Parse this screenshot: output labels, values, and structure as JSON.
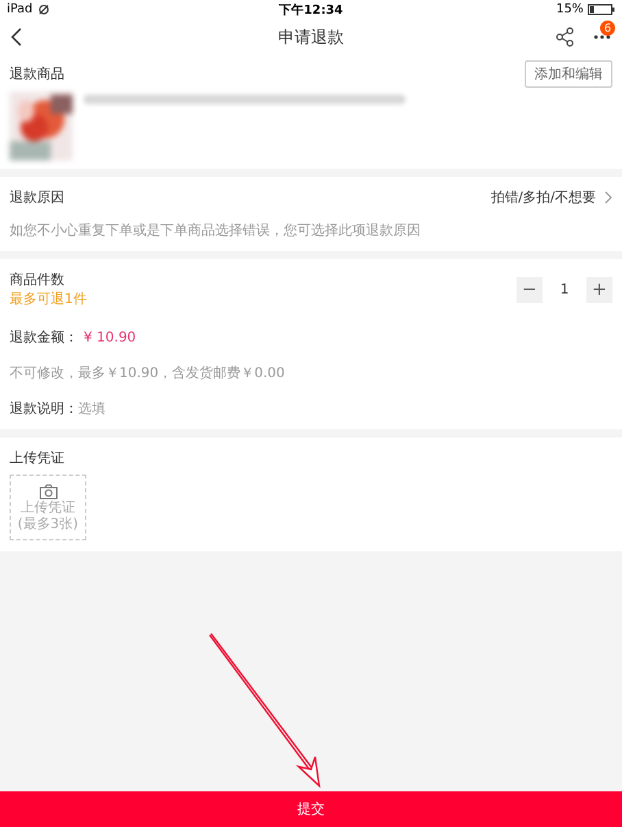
{
  "status_bar": {
    "device": "iPad",
    "time": "下午12:34",
    "battery": "15%"
  },
  "nav": {
    "title": "申请退款",
    "badge": "6"
  },
  "items_section": {
    "title": "退款商品",
    "button": "添加和编辑"
  },
  "reason": {
    "label": "退款原因",
    "value": "拍错/多拍/不想要",
    "hint": "如您不小心重复下单或是下单商品选择错误，您可选择此项退款原因"
  },
  "quantity": {
    "label": "商品件数",
    "limit": "最多可退1件",
    "minus": "−",
    "value": "1",
    "plus": "+"
  },
  "amount": {
    "label": "退款金额：",
    "value": "¥ 10.90",
    "note": "不可修改，最多￥10.90，含发货邮费￥0.00"
  },
  "description": {
    "label": "退款说明：",
    "placeholder": "选填"
  },
  "upload": {
    "title": "上传凭证",
    "lines": [
      "上传凭证",
      "(最多3张)"
    ]
  },
  "submit": "提交"
}
